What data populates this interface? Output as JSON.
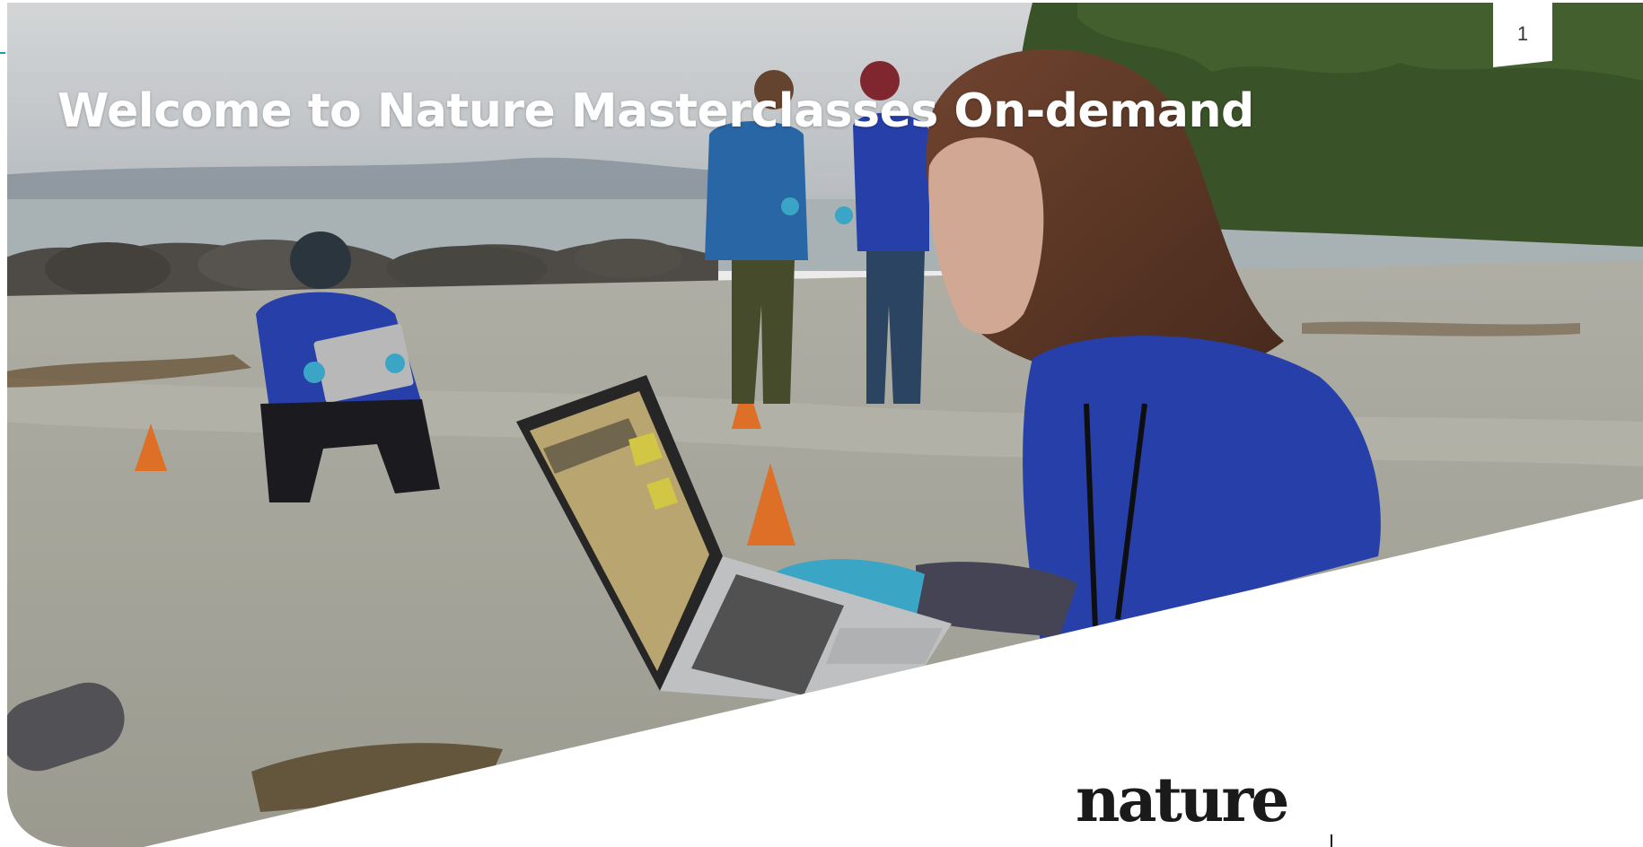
{
  "slide": {
    "title": "Welcome to Nature Masterclasses On-demand",
    "page_number": "1"
  },
  "hero_image": {
    "icon": "beach-field-research-photo",
    "colors": {
      "sky": "#d9dde0",
      "water": "#b9c2c6",
      "sand": "#b7b7ad",
      "trees": "#3f5a2c",
      "shirt_blue": "#2b45b8",
      "cone_orange": "#f07a2a",
      "gloves": "#3fb4d6"
    }
  },
  "logo": {
    "text": "nature",
    "icon": "nature-logo"
  },
  "colors": {
    "accent": "#1a9bb0",
    "title_text": "#ffffff",
    "background": "#ffffff"
  }
}
